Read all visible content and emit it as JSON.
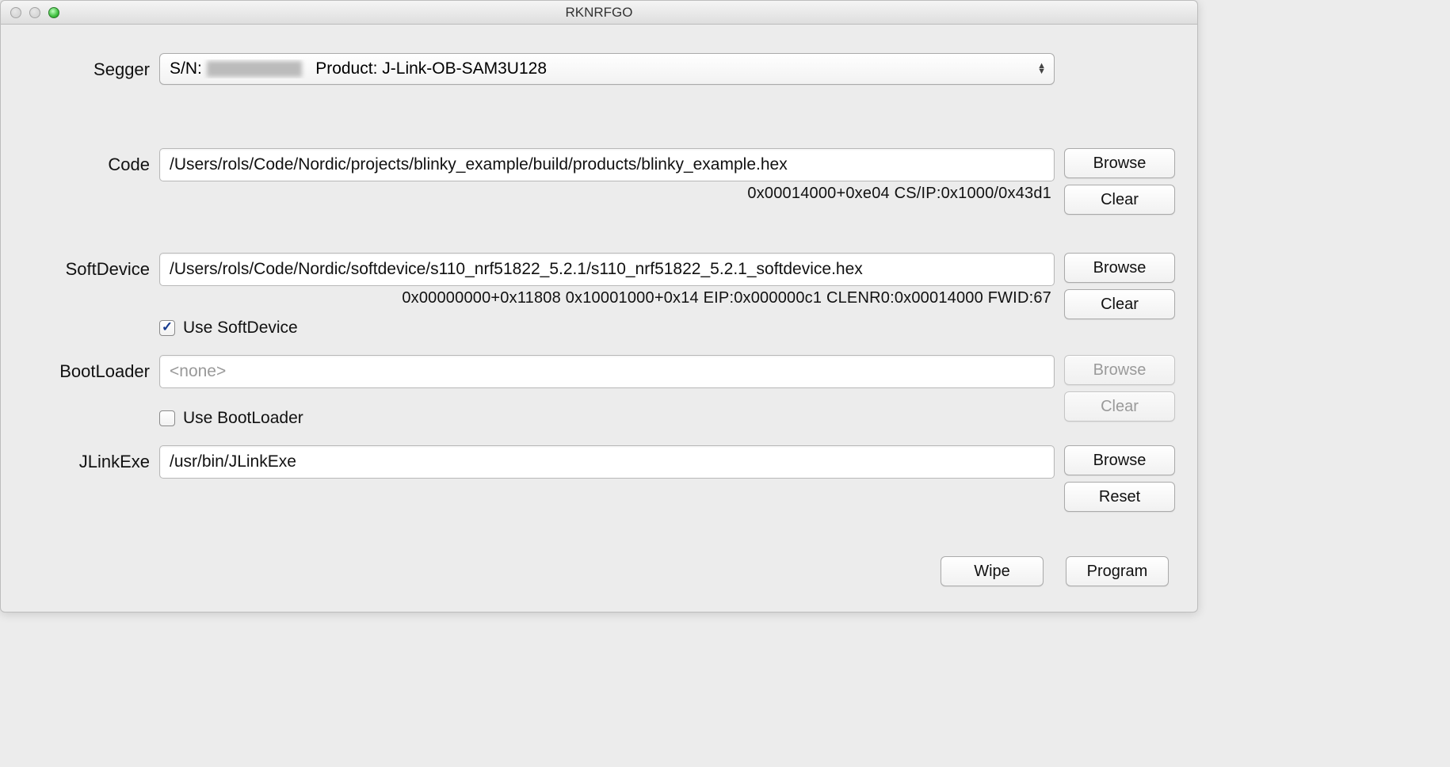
{
  "window": {
    "title": "RKNRFGO"
  },
  "segger": {
    "label": "Segger",
    "sn_prefix": "S/N:",
    "product_prefix": "Product:",
    "product": "J-Link-OB-SAM3U128"
  },
  "code": {
    "label": "Code",
    "path": "/Users/rols/Code/Nordic/projects/blinky_example/build/products/blinky_example.hex",
    "info": "0x00014000+0xe04    CS/IP:0x1000/0x43d1",
    "browse": "Browse",
    "clear": "Clear"
  },
  "softdevice": {
    "label": "SoftDevice",
    "path": "/Users/rols/Code/Nordic/softdevice/s110_nrf51822_5.2.1/s110_nrf51822_5.2.1_softdevice.hex",
    "info": "0x00000000+0x11808    0x10001000+0x14    EIP:0x000000c1   CLENR0:0x00014000   FWID:67",
    "checkbox_label": "Use SoftDevice",
    "checked": true,
    "browse": "Browse",
    "clear": "Clear"
  },
  "bootloader": {
    "label": "BootLoader",
    "placeholder": "<none>",
    "checkbox_label": "Use BootLoader",
    "checked": false,
    "browse": "Browse",
    "clear": "Clear"
  },
  "jlink": {
    "label": "JLinkExe",
    "path": "/usr/bin/JLinkExe",
    "browse": "Browse",
    "reset": "Reset"
  },
  "actions": {
    "wipe": "Wipe",
    "program": "Program"
  }
}
